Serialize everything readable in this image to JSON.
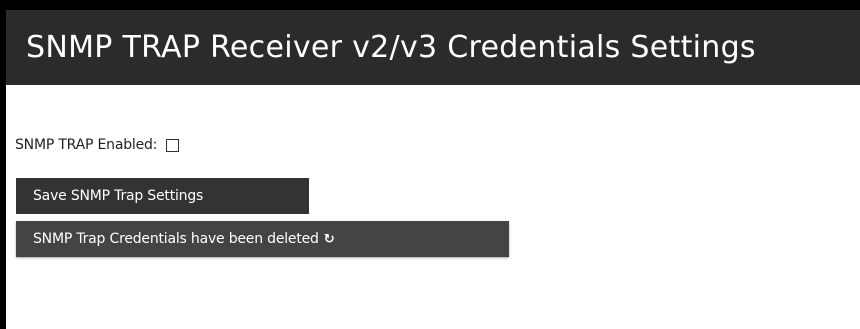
{
  "header": {
    "title": "SNMP TRAP Receiver v2/v3 Credentials Settings"
  },
  "form": {
    "enabled_label": "SNMP TRAP Enabled:",
    "enabled_checked": false,
    "save_button_label": "Save SNMP Trap Settings",
    "status_button_label": "SNMP Trap Credentials have been deleted",
    "status_icon": "refresh-icon"
  },
  "colors": {
    "header_bg": "#2b2b2b",
    "button_bg": "#333333",
    "frame_bg": "#000000"
  }
}
